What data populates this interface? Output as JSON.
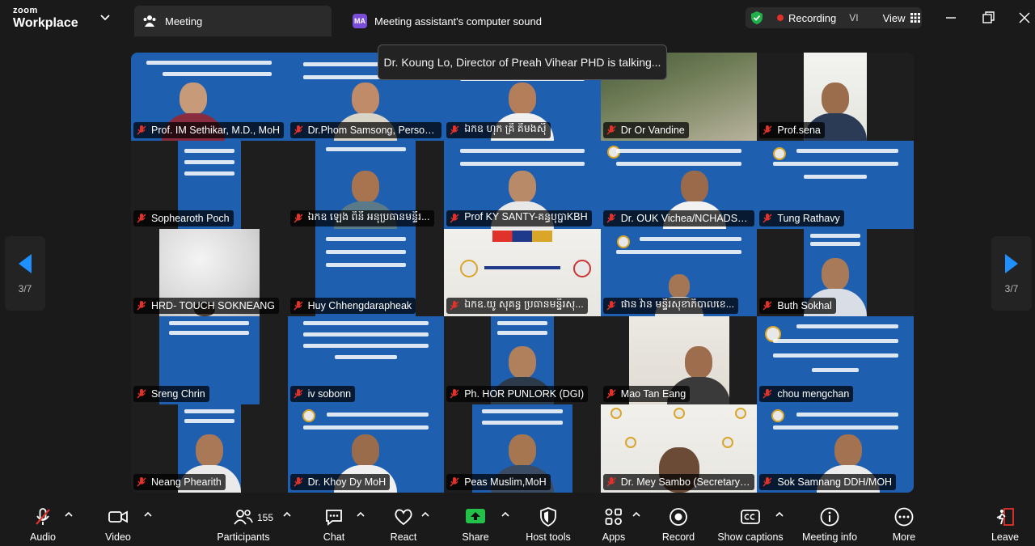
{
  "titlebar": {
    "brand_top": "zoom",
    "brand_bottom": "Workplace",
    "meeting_tab": "Meeting",
    "assistant_badge": "MA",
    "assistant_tab": "Meeting assistant's computer sound",
    "recording": "Recording",
    "language": "VI",
    "view": "View"
  },
  "speaker_tip": "Dr. Koung Lo, Director of Preah Vihear PHD is talking...",
  "colors": {
    "accent_blue": "#1f5fb0",
    "muted_red": "#e0312a",
    "share_green": "#24c14a",
    "shield_green": "#1fb14a"
  },
  "participants": [
    "Prof. IM Sethikar, M.D., MoH",
    "Dr.Phom Samsong, Personn...",
    "ឯកឧ ហុក គ្រី គីមងស៊ី",
    "Dr Or Vandine",
    "Prof.sena",
    "Sophearoth Poch",
    "ឯកឧ ឡេង ពិនី អនុប្រធានមន្ទីរ...",
    "Prof KY SANTY-គន្ធបុប្ផាKBH",
    "Dr. OUK Vichea/NCHADS-M...",
    "Tung Rathavy",
    "HRD- TOUCH SOKNEANG",
    "Huy Chhengdarapheak",
    "ឯកឧ.យូ សុគន្ធ ប្រធានមន្ទីរសុ...",
    "ផាន វ៉ាន មន្ទីរសុខាភិបាលខេ...",
    "Buth Sokhal",
    "Sreng Chrin",
    "iv sobonn",
    "Ph. HOR PUNLORK (DGI)",
    "Mao Tan Eang",
    "chou mengchan",
    "Neang Phearith",
    "Dr. Khoy Dy MoH",
    "Peas Muslim,MoH",
    "Dr. Mey Sambo (Secretary of...",
    "Sok Samnang DDH/MOH"
  ],
  "pager": {
    "left": "3/7",
    "right": "3/7"
  },
  "toolbar": {
    "audio": "Audio",
    "video": "Video",
    "participants": "Participants",
    "participants_count": "155",
    "chat": "Chat",
    "react": "React",
    "share": "Share",
    "host_tools": "Host tools",
    "apps": "Apps",
    "record": "Record",
    "show_captions": "Show captions",
    "meeting_info": "Meeting info",
    "more": "More",
    "leave": "Leave"
  }
}
